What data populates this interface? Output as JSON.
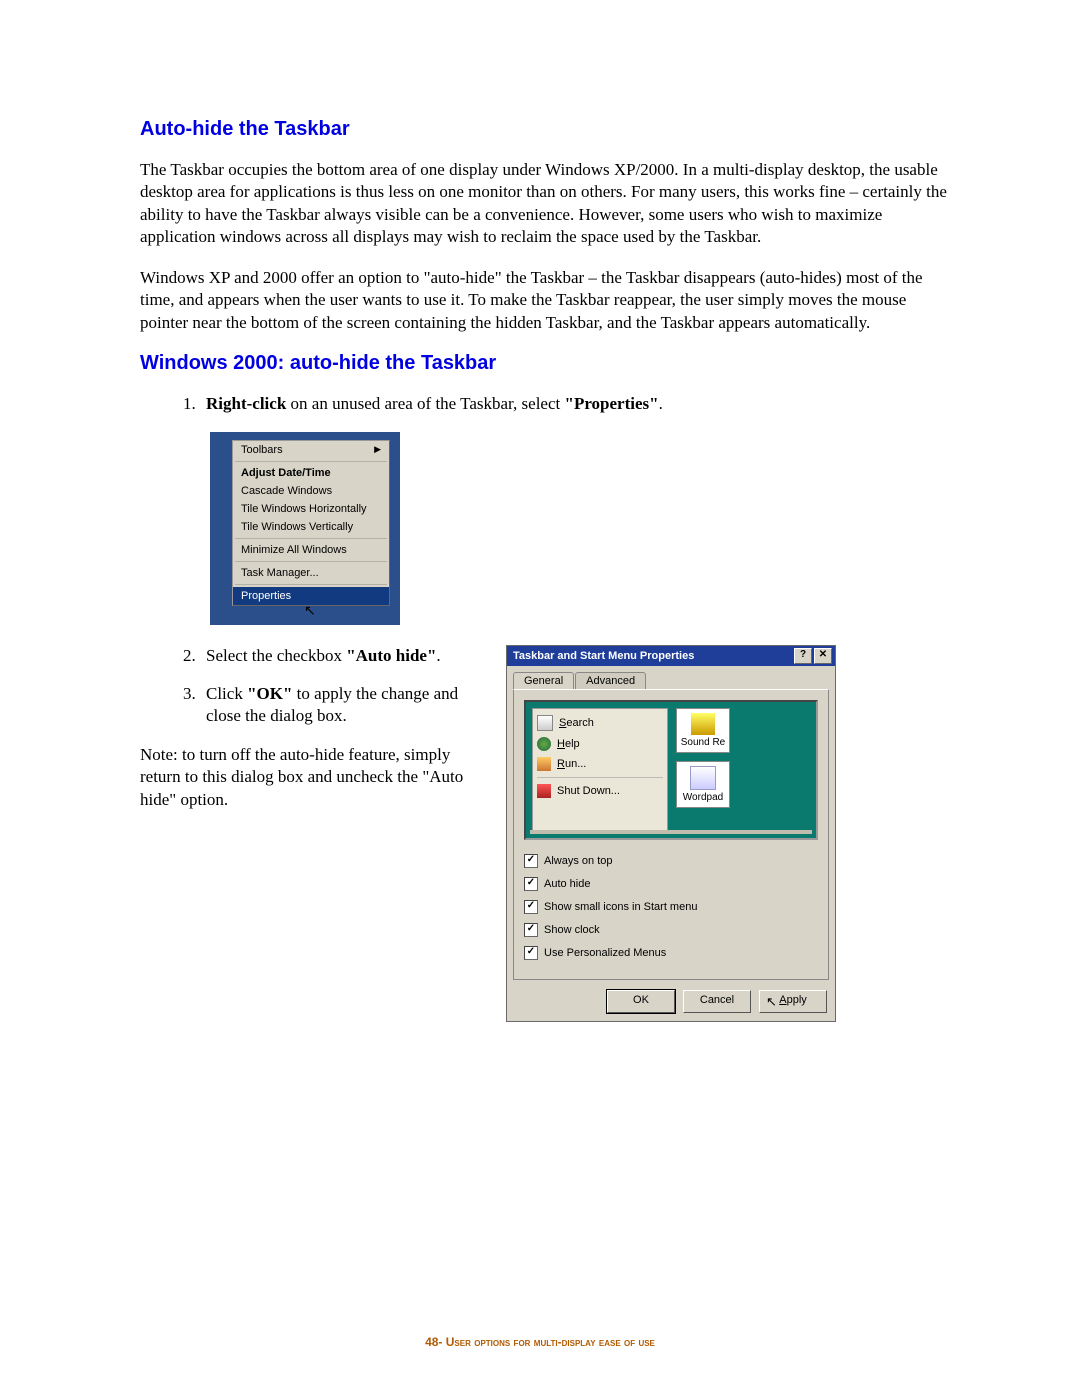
{
  "heading1": "Auto-hide the Taskbar",
  "para1": "The Taskbar occupies the bottom area of one display under Windows XP/2000. In a multi-display desktop, the usable desktop area for applications is thus less on one monitor than on others. For many users, this works fine – certainly the ability to have the Taskbar always visible can be a convenience. However, some users who wish to maximize application windows across all displays may wish to reclaim the space used by the Taskbar.",
  "para2": "Windows XP and 2000 offer an option to \"auto-hide\" the Taskbar – the Taskbar disappears (auto-hides) most of the time, and appears when the user wants to use it. To make the Taskbar reappear, the user simply moves the mouse pointer near the bottom of the screen containing the hidden Taskbar, and the Taskbar appears automatically.",
  "heading2": "Windows 2000: auto-hide the Taskbar",
  "step1_b1": "Right-click",
  "step1_mid": " on an unused area of the Taskbar, select ",
  "step1_b2": "\"Properties\"",
  "step1_end": ".",
  "step2_a": "Select the checkbox ",
  "step2_b": "\"Auto hide\"",
  "step2_c": ".",
  "step3_a": "Click ",
  "step3_b": "\"OK\"",
  "step3_c": " to apply the change and close the dialog box.",
  "note": "Note: to turn off the auto-hide feature, simply return to this dialog box and uncheck the \"Auto hide\" option.",
  "footer_num": "48- ",
  "footer_text": "User options for multi-display ease of use",
  "fig1": {
    "items": {
      "toolbars": "Toolbars",
      "adjust": "Adjust Date/Time",
      "cascade": "Cascade Windows",
      "tileh": "Tile Windows Horizontally",
      "tilev": "Tile Windows Vertically",
      "min": "Minimize All Windows",
      "task": "Task Manager...",
      "props": "Properties"
    }
  },
  "fig2": {
    "title": "Taskbar and Start Menu Properties",
    "tab1": "General",
    "tab2": "Advanced",
    "start": {
      "search": "Search",
      "help": "Help",
      "run": "Run...",
      "shut": "Shut Down..."
    },
    "desk": {
      "sound": "Sound Re",
      "wordpad": "Wordpad"
    },
    "checks": {
      "c1": "Always on top",
      "c2": "Auto hide",
      "c3": "Show small icons in Start menu",
      "c4": "Show clock",
      "c5": "Use Personalized Menus"
    },
    "btns": {
      "ok": "OK",
      "cancel": "Cancel",
      "apply": "Apply"
    }
  }
}
